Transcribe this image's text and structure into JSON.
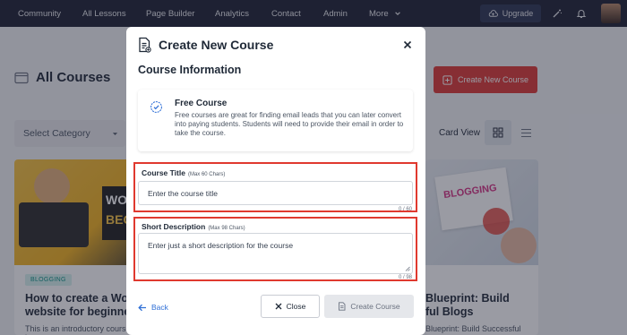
{
  "nav": {
    "items": [
      "Community",
      "All Lessons",
      "Page Builder",
      "Analytics",
      "Contact",
      "Admin",
      "More"
    ],
    "upgrade_label": "Upgrade"
  },
  "page": {
    "title": "All Courses",
    "create_button": "Create New Course",
    "category_select": "Select Category",
    "card_view_label": "Card View"
  },
  "cards": [
    {
      "tag": "BLOGGING",
      "title": "How to create a Wor… website for beginne…",
      "title_line1": "How to create a Word",
      "title_line2": "website for beginners",
      "desc": "This is an introductory course on how to",
      "image_text_1": "WO",
      "image_text_2": "BEG"
    },
    {
      "title_line1": "Blueprint: Build",
      "title_line2": "ful Blogs",
      "desc": "Blueprint: Build Successful",
      "image_text": "BLOGGING"
    }
  ],
  "modal": {
    "title": "Create New Course",
    "section_title": "Course Information",
    "info": {
      "title": "Free Course",
      "text": "Free courses are great for finding email leads that you can later convert into paying students. Students will need to provide their email in order to take the course."
    },
    "course_title": {
      "label": "Course Title",
      "hint": "(Max 60 Chars)",
      "placeholder": "Enter the course title",
      "counter": "0 / 60"
    },
    "short_description": {
      "label": "Short Description",
      "hint": "(Max 98 Chars)",
      "placeholder": "Enter just a short description for the course",
      "counter": "0 / 98"
    },
    "back_label": "Back",
    "close_label": "Close",
    "create_label": "Create Course"
  },
  "colors": {
    "nav_bg": "#1e2233",
    "accent_red": "#dc3a35",
    "link_blue": "#2f6fd6",
    "highlight_border": "#e0392f"
  }
}
